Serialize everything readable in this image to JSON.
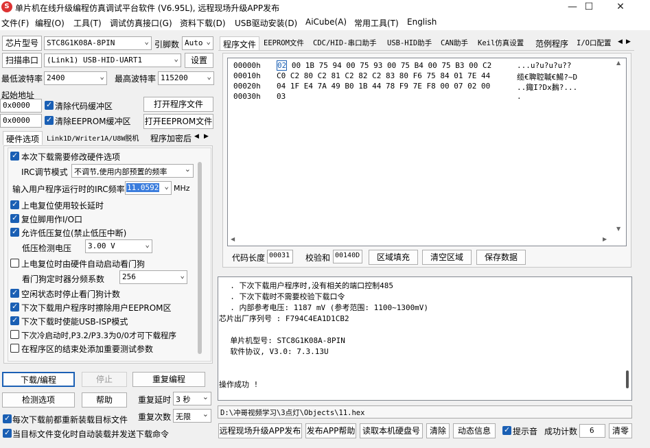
{
  "window": {
    "title": "单片机在线升级编程仿真调试平台软件 (V6.95L), 远程现场升级APP发布",
    "icon_text": "S",
    "minimize_icon": "—",
    "maximize_icon": "☐",
    "close_icon": "✕"
  },
  "menu": [
    "文件(F)",
    "编程(O)",
    "工具(T)",
    "调试仿真接口(G)",
    "资料下载(D)",
    "USB驱动安装(D)",
    "AiCube(A)",
    "常用工具(T)",
    "English"
  ],
  "left": {
    "chip_type_btn": "芯片型号",
    "chip_type_value": "STC8G1K08A-8PIN",
    "pin_count_label": "引脚数",
    "pin_count_value": "Auto",
    "scan_port_btn": "扫描串口",
    "port_value": "(Link1) USB-HID-UART1",
    "settings_btn": "设置",
    "min_baud_label": "最低波特率",
    "min_baud_value": "2400",
    "max_baud_label": "最高波特率",
    "max_baud_value": "115200",
    "start_addr_label": "起始地址",
    "addr1": "0x0000",
    "clear_code_label": "清除代码缓冲区",
    "open_prog_btn": "打开程序文件",
    "addr2": "0x0000",
    "clear_eeprom_label": "清除EEPROM缓冲区",
    "open_eeprom_btn": "打开EEPROM文件",
    "tabs": [
      "硬件选项",
      "Link1D/Writer1A/U8W脱机",
      "程序加密后"
    ],
    "hw_options": {
      "modify_hw_label": "本次下载需要修改硬件选项",
      "irc_mode_label": "IRC调节模式",
      "irc_mode_value": "不调节,使用内部预置的频率",
      "irc_freq_label": "输入用户程序运行时的IRC频率",
      "irc_freq_value": "11.0592",
      "irc_unit": "MHz",
      "power_reset_label": "上电复位使用较长延时",
      "reset_pin_label": "复位脚用作I/O口",
      "lvr_label": "允许低压复位(禁止低压中断)",
      "lvd_label": "低压检测电压",
      "lvd_value": "3.00 V",
      "wdt_auto_label": "上电复位时由硬件自动启动看门狗",
      "wdt_div_label": "看门狗定时器分频系数",
      "wdt_div_value": "256",
      "idle_wdt_label": "空闲状态时停止看门狗计数",
      "erase_eeprom_label": "下次下载用户程序时擦除用户EEPROM区",
      "usb_isp_label": "下次下载时使能USB-ISP模式",
      "cold_boot_label": "下次冷启动时,P3.2/P3.3为0/0才可下载程序",
      "test_param_label": "在程序区的结束处添加重要测试参数"
    },
    "download_btn": "下载/编程",
    "stop_btn": "停止",
    "reprogram_btn": "重复编程",
    "check_btn": "检测选项",
    "help_btn": "帮助",
    "repeat_delay_label": "重复延时",
    "repeat_delay_value": "3 秒",
    "repeat_count_label": "重复次数",
    "repeat_count_value": "无限",
    "reload_label": "每次下载前都重新装载目标文件",
    "auto_load_label": "当目标文件变化时自动装载并发送下载命令"
  },
  "right": {
    "tabs": [
      "程序文件",
      "EEPROM文件",
      "CDC/HID-串口助手",
      "USB-HID助手",
      "CAN助手",
      "Keil仿真设置",
      "范例程序",
      "I/O口配置"
    ],
    "hex_rows": [
      {
        "addr": "00000h",
        "bytes": "02 00 1B 75 94 00 75 93 00 75 B4 00 75 B3 00 C2",
        "ascii": "...u?u?u?u??"
      },
      {
        "addr": "00010h",
        "bytes": "C0 C2 80 C2 81 C2 82 C2 83 80 F6 75 84 01 7E 44",
        "ascii": "缆€聛聜聝€鰑?~D"
      },
      {
        "addr": "00020h",
        "bytes": "04 1F E4 7A 49 B0 1B 44 78 F9 7E F8 00 07 02 00",
        "ascii": "..鋷I?Dx鶈?..."
      },
      {
        "addr": "00030h",
        "bytes": "03",
        "ascii": "."
      }
    ],
    "code_len_label": "代码长度",
    "code_len_value": "00031",
    "checksum_label": "校验和",
    "checksum_value": "00140D",
    "fill_btn": "区域填充",
    "clear_area_btn": "清空区域",
    "save_btn": "保存数据",
    "log_lines": [
      "  . 下次下载用户程序时,没有相关的端口控制485",
      "  . 下次下载时不需要校验下载口令",
      "  . 内部参考电压: 1187 mV (参考范围: 1100~1300mV)",
      "芯片出厂序列号 : F794C4EA1D1CB2",
      "",
      "  单片机型号: STC8G1K08A-8PIN",
      "  软件协议, V3.0: 7.3.13U",
      "",
      "",
      "",
      "操作成功 !"
    ],
    "file_path": "D:\\冲哥视频学习\\3点灯\\Objects\\11.hex",
    "remote_btn": "远程现场升级APP发布",
    "publish_help_btn": "发布APP帮助",
    "read_disk_btn": "读取本机硬盘号",
    "clear_btn": "清除",
    "dynamic_btn": "动态信息",
    "beep_label": "提示音",
    "success_label": "成功计数",
    "success_value": "6",
    "clear_count_btn": "清零"
  },
  "colors": {
    "accent": "#1a5fb4",
    "selection": "#3b7ddd"
  }
}
